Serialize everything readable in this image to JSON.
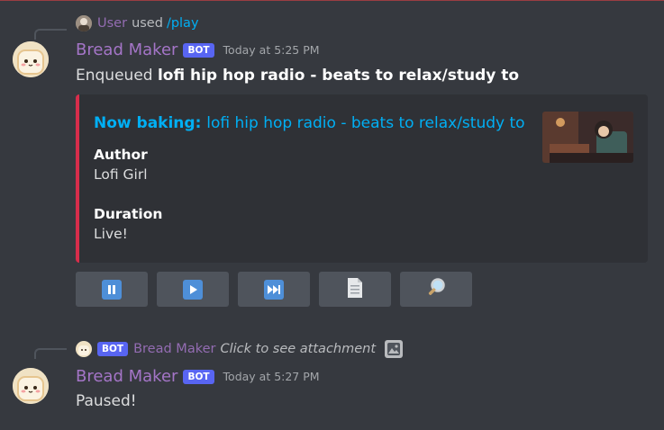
{
  "messages": [
    {
      "reply": {
        "user": "User",
        "used_text": "used",
        "command": "/play"
      },
      "author": "Bread Maker",
      "bot_tag": "BOT",
      "timestamp": "Today at 5:25 PM",
      "content_prefix": "Enqueued ",
      "content_bold": "lofi hip hop radio - beats to relax/study to",
      "embed": {
        "color": "#d72d4b",
        "title_prefix": "Now baking: ",
        "title_link": "lofi hip hop radio - beats to relax/study to",
        "fields": [
          {
            "name": "Author",
            "value": "Lofi Girl"
          },
          {
            "name": "Duration",
            "value": "Live!"
          }
        ]
      },
      "buttons": [
        {
          "icon": "pause-icon"
        },
        {
          "icon": "play-icon"
        },
        {
          "icon": "skip-icon"
        },
        {
          "icon": "page-icon"
        },
        {
          "icon": "magnifier-icon"
        }
      ]
    },
    {
      "reply": {
        "bot_tag": "BOT",
        "user": "Bread Maker",
        "text": "Click to see attachment",
        "icon": "image-icon"
      },
      "author": "Bread Maker",
      "bot_tag": "BOT",
      "timestamp": "Today at 5:27 PM",
      "content": "Paused!"
    }
  ],
  "colors": {
    "background": "#36393f",
    "username": "#a475c7",
    "link": "#00aff4",
    "bot_tag": "#5865f2",
    "button": "#4f545c",
    "button_glyph": "#4e8fd8"
  }
}
